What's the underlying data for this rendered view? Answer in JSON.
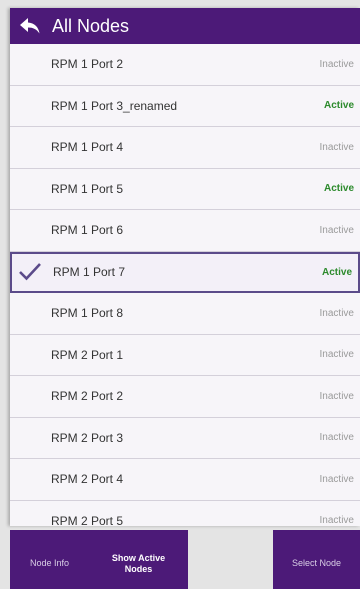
{
  "header": {
    "title": "All Nodes",
    "back_icon": "back-arrow-icon"
  },
  "nodes": [
    {
      "name": "RPM 1 Port 2",
      "status": "Inactive",
      "selected": false
    },
    {
      "name": "RPM 1 Port 3_renamed",
      "status": "Active",
      "selected": false
    },
    {
      "name": "RPM 1 Port 4",
      "status": "Inactive",
      "selected": false
    },
    {
      "name": "RPM 1 Port 5",
      "status": "Active",
      "selected": false
    },
    {
      "name": "RPM 1 Port 6",
      "status": "Inactive",
      "selected": false
    },
    {
      "name": "RPM 1 Port 7",
      "status": "Active",
      "selected": true
    },
    {
      "name": "RPM 1 Port 8",
      "status": "Inactive",
      "selected": false
    },
    {
      "name": "RPM 2 Port 1",
      "status": "Inactive",
      "selected": false
    },
    {
      "name": "RPM 2 Port 2",
      "status": "Inactive",
      "selected": false
    },
    {
      "name": "RPM 2 Port 3",
      "status": "Inactive",
      "selected": false
    },
    {
      "name": "RPM 2 Port 4",
      "status": "Inactive",
      "selected": false
    },
    {
      "name": "RPM 2 Port 5",
      "status": "Inactive",
      "selected": false
    }
  ],
  "footer": {
    "node_info": "Node Info",
    "show_active_line1": "Show Active",
    "show_active_line2": "Nodes",
    "select_node": "Select Node"
  },
  "colors": {
    "brand": "#4c1a78",
    "active": "#2c8a2c",
    "inactive": "#9a9a9a",
    "selected_border": "#5b4b8a"
  }
}
